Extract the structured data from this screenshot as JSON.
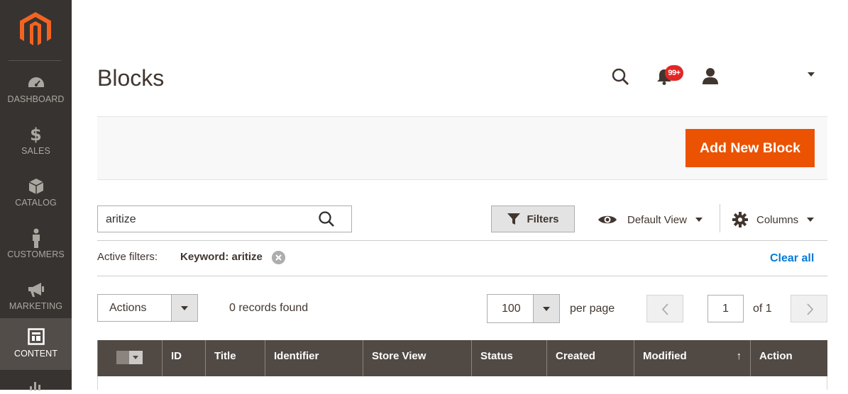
{
  "sidebar": {
    "logo": "magento-logo",
    "items": [
      {
        "label": "DASHBOARD",
        "icon": "dashboard-icon"
      },
      {
        "label": "SALES",
        "icon": "dollar-icon"
      },
      {
        "label": "CATALOG",
        "icon": "box-icon"
      },
      {
        "label": "CUSTOMERS",
        "icon": "person-icon"
      },
      {
        "label": "MARKETING",
        "icon": "megaphone-icon"
      },
      {
        "label": "CONTENT",
        "icon": "layout-icon",
        "active": true
      }
    ]
  },
  "header": {
    "title": "Blocks",
    "notifications_badge": "99+"
  },
  "toolbar": {
    "add_button": "Add New Block"
  },
  "search": {
    "value": "aritize"
  },
  "controls": {
    "filters_label": "Filters",
    "view_label": "Default View",
    "columns_label": "Columns"
  },
  "active_filters": {
    "label": "Active filters:",
    "keyword": "Keyword: aritize",
    "clear_all": "Clear all"
  },
  "grid_toolbar": {
    "actions_label": "Actions",
    "records_found": "0 records found",
    "per_page_value": "100",
    "per_page_label": "per page",
    "current_page": "1",
    "of_pages": "of 1"
  },
  "table": {
    "columns": [
      "ID",
      "Title",
      "Identifier",
      "Store View",
      "Status",
      "Created",
      "Modified",
      "Action"
    ],
    "sort_indicator": "↑"
  },
  "colors": {
    "accent": "#eb5202",
    "sidebar_bg": "#373330",
    "table_header_bg": "#514943",
    "link": "#007bdb"
  }
}
